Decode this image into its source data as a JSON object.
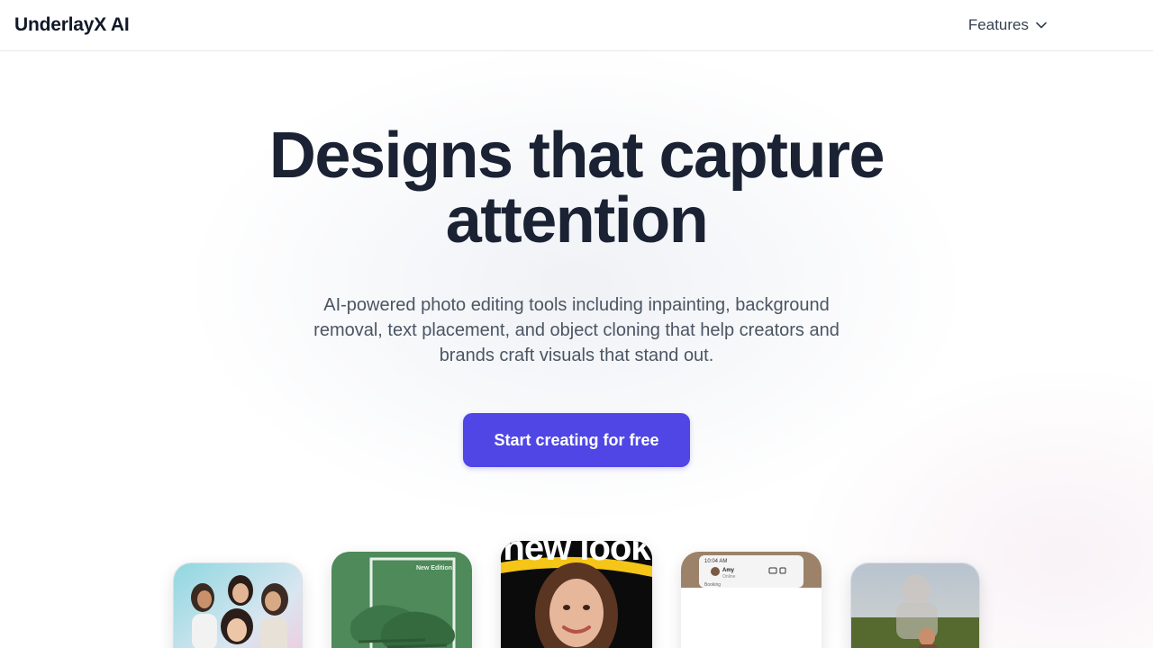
{
  "header": {
    "brand": "UnderlayX AI",
    "nav": {
      "features_label": "Features",
      "features_icon": "chevron-down-icon"
    }
  },
  "hero": {
    "title_line1": "Designs that capture",
    "title_line2": "attention",
    "subtitle": "AI-powered photo editing tools including inpainting, background removal, text placement, and object cloning that help creators and brands craft visuals that stand out.",
    "cta_label": "Start creating for free"
  },
  "showcase": {
    "card2_text": "New Edition",
    "card3_headline": "new look",
    "card4_time": "10:04 AM",
    "card4_contact": "Amy",
    "card4_presence": "Online",
    "card4_snippet": "Booking"
  },
  "colors": {
    "accent": "#4f46e5",
    "title": "#1a2233",
    "subtitle": "#4b5563",
    "card2_bg": "#4e8a5a",
    "card3_text": "#ffffff",
    "card3_band": "#f5c518"
  }
}
